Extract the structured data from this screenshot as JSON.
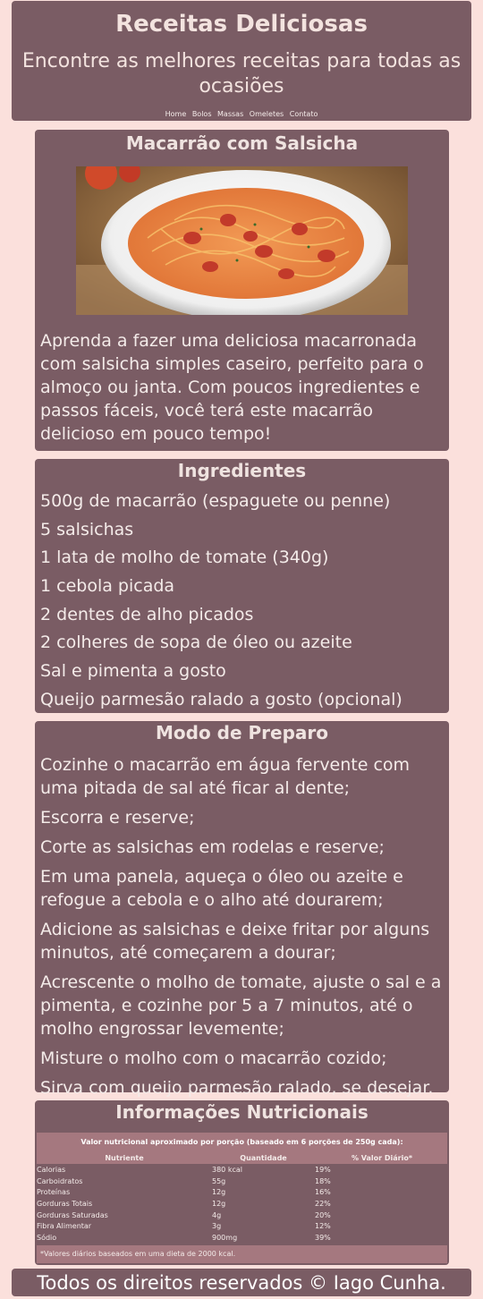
{
  "header": {
    "title": "Receitas Deliciosas",
    "subtitle": "Encontre as melhores receitas para todas as ocasiões",
    "nav": [
      "Home",
      "Bolos",
      "Massas",
      "Omeletes",
      "Contato"
    ]
  },
  "recipe": {
    "title": "Macarrão com Salsicha",
    "description": "Aprenda a fazer uma deliciosa macarronada com salsicha simples caseiro, perfeito para o almoço ou janta. Com poucos ingredientes e passos fáceis, você terá este macarrão delicioso em pouco tempo!"
  },
  "ingredients": {
    "title": "Ingredientes",
    "items": [
      "500g de macarrão (espaguete ou penne)",
      "5 salsichas",
      "1 lata de molho de tomate (340g)",
      "1 cebola picada",
      "2 dentes de alho picados",
      "2 colheres de sopa de óleo ou azeite",
      "Sal e pimenta a gosto",
      "Queijo parmesão ralado a gosto (opcional)"
    ]
  },
  "method": {
    "title": "Modo de Preparo",
    "steps": [
      "Cozinhe o macarrão em água fervente com uma pitada de sal até ficar al dente;",
      "Escorra e reserve;",
      "Corte as salsichas em rodelas e reserve;",
      "Em uma panela, aqueça o óleo ou azeite e refogue a cebola e o alho até dourarem;",
      "Adicione as salsichas e deixe fritar por alguns minutos, até começarem a dourar;",
      "Acrescente o molho de tomate, ajuste o sal e a pimenta, e cozinhe por 5 a 7 minutos, até o molho engrossar levemente;",
      "Misture o molho com o macarrão cozido;",
      "Sirva com queijo parmesão ralado, se desejar."
    ]
  },
  "nutrition": {
    "title": "Informações Nutricionais",
    "caption": "Valor nutricional aproximado por porção (baseado em 6 porções de 250g cada):",
    "columns": [
      "Nutriente",
      "Quantidade",
      "% Valor Diário*"
    ],
    "rows": [
      [
        "Calorias",
        "380 kcal",
        "19%"
      ],
      [
        "Carboidratos",
        "55g",
        "18%"
      ],
      [
        "Proteínas",
        "12g",
        "16%"
      ],
      [
        "Gorduras Totais",
        "12g",
        "22%"
      ],
      [
        "Gorduras Saturadas",
        "4g",
        "20%"
      ],
      [
        "Fibra Alimentar",
        "3g",
        "12%"
      ],
      [
        "Sódio",
        "900mg",
        "39%"
      ]
    ],
    "footnote": "*Valores diários baseados em uma dieta de 2000 kcal."
  },
  "footer": {
    "text": "Todos os direitos reservados © Iago Cunha."
  },
  "colors": {
    "page_bg": "#fbe0dc",
    "panel_bg": "#7a5c64",
    "table_header_bg": "#a5787f"
  }
}
